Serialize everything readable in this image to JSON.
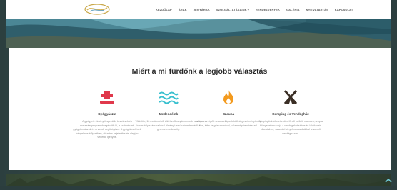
{
  "brand": {
    "logo_icon": "logo-swirl-icon",
    "logo_color": "#c9a84a"
  },
  "nav": {
    "items": [
      {
        "label": "Kezdőlap"
      },
      {
        "label": "Árak"
      },
      {
        "label": "Jegyárak"
      },
      {
        "label": "Szolgáltatásaink",
        "has_dropdown": true
      },
      {
        "label": "Rendezvények"
      },
      {
        "label": "Galéria"
      },
      {
        "label": "Nyitvatartás"
      },
      {
        "label": "Kapcsolat"
      }
    ],
    "dropdown_icon": "chevron-down-icon"
  },
  "section": {
    "title": "Miért a mi fürdőnk a legjobb választás",
    "features": [
      {
        "icon": "medical-cross-icon",
        "color": "#e0384b",
        "title": "Gyógyászat",
        "desc": "A gyógyvíz élményét speciális kezelések és masszázsprogramok egészítik ki, a szakképzett gyógytornászok és orvosok segítségével. A gyógykezelések kényelmes időpontban, előzetes bejelentkezés alapján vehetők igénybe."
      },
      {
        "icon": "water-waves-icon",
        "color": "#39c0cf",
        "title": "Medencéink",
        "desc": "Többféle, 10 medencéből álló fürdőkomplexumunk minden korosztály számára kínál élményt: az úszómedencétől a gyermekmedencéig."
      },
      {
        "icon": "flame-icon",
        "color": "#f39a1e",
        "title": "Szauna",
        "desc": "Az újonnan épült szaunavilágunk különleges élményt nyújt finn, infra és gőzszaunával, valamint pihenőrésszel."
      },
      {
        "icon": "tent-icon",
        "color": "#3a2e25",
        "title": "Kemping és Vendégház",
        "desc": "Kempingünk közvetlenül a fürdő mellett, csendes, árnyas környezetben várja a vendégeket sátras és lakókocsis pihenéshez, valamint kényelmes szobákkal felszerelt vendégházzal."
      }
    ]
  },
  "scroll_top_icon": "chevron-up-icon"
}
